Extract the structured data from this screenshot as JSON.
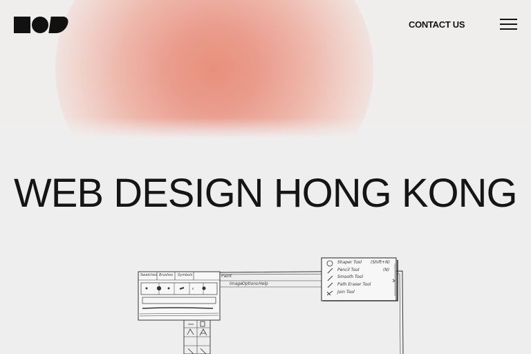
{
  "header": {
    "logo_label": "NOD logo",
    "contact_label": "CONTACT US",
    "menu_icon": "hamburger-menu-icon"
  },
  "hero": {
    "headline": "WEB DESIGN HONG KONG",
    "blob_color": "#e8907e",
    "background": "#efeeee"
  },
  "illustration": {
    "swatch_tabs": [
      "Swatches",
      "Brushes",
      "Symbols"
    ],
    "menu_bar": [
      "Paint",
      "Image",
      "Options",
      "Help"
    ],
    "tool_menu": [
      {
        "label": "Shaper Tool",
        "shortcut": "(Shift+N)"
      },
      {
        "label": "Pencil Tool",
        "shortcut": "(N)"
      },
      {
        "label": "Smooth Tool",
        "shortcut": ""
      },
      {
        "label": "Path Eraser Tool",
        "shortcut": ""
      },
      {
        "label": "Join Tool",
        "shortcut": ""
      }
    ]
  }
}
